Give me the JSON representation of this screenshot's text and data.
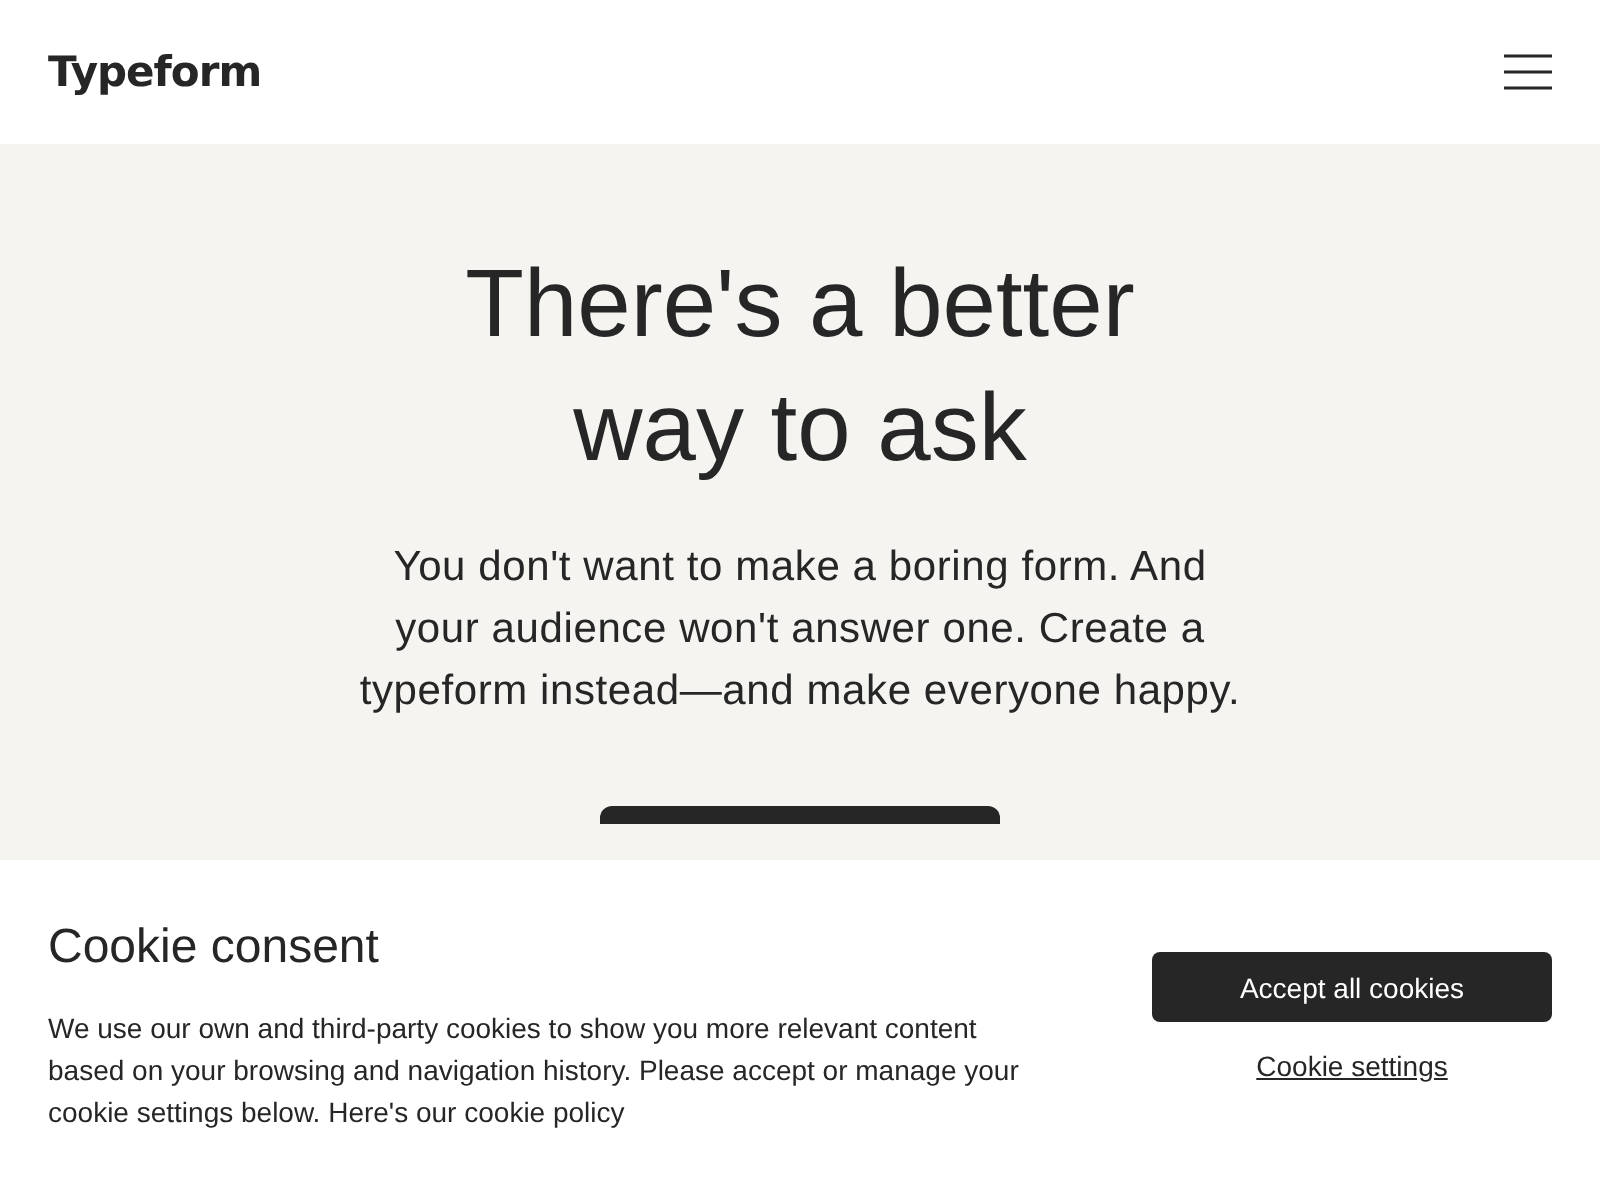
{
  "header": {
    "logo": "Typeform"
  },
  "hero": {
    "title_lines": [
      "There's a better",
      "way to ask"
    ],
    "text": "You don't want to make a boring form. And your audience won't answer one. Create a typeform instead—and make everyone happy."
  },
  "cookie_banner": {
    "title": "Cookie consent",
    "text": "We use our own and third-party cookies to show you more relevant content based on your browsing and navigation history. Please accept or manage your cookie settings below. Here's our ",
    "link": "cookie policy",
    "buttons": [
      {
        "label": "Accept all cookies",
        "kind": "primary"
      },
      {
        "label": "Cookie settings",
        "kind": "link"
      }
    ]
  }
}
